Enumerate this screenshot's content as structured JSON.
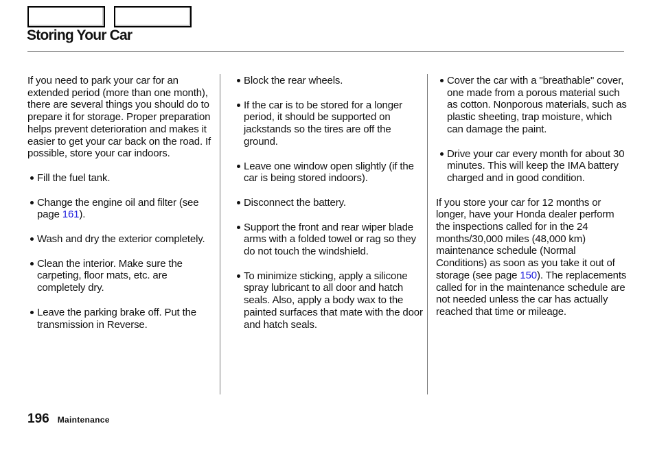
{
  "header": {
    "nav_buttons": [
      {
        "name": "nav-button-previous",
        "label": ""
      },
      {
        "name": "nav-button-next",
        "label": ""
      }
    ],
    "title": "Storing Your Car"
  },
  "columns": {
    "col1": {
      "intro": "If you need to park your car for an extended period (more than one month), there are several things you should do to prepare it for storage. Proper preparation helps prevent deterioration and makes it easier to get your car back on the road. If possible, store your car indoors.",
      "bullets": [
        {
          "text": "Fill the fuel tank."
        },
        {
          "text_before": "Change the engine oil and filter (see page ",
          "link": "161",
          "text_after": ")."
        },
        {
          "text": "Wash and dry the exterior completely."
        },
        {
          "text": "Clean the interior. Make sure the carpeting, floor mats, etc. are completely dry."
        },
        {
          "text": "Leave the parking brake off. Put the transmission in Reverse."
        }
      ]
    },
    "col2": {
      "bullets": [
        {
          "text": "Block the rear wheels."
        },
        {
          "text": "If the car is to be stored for a longer period, it should be supported on jackstands so the tires are off the ground."
        },
        {
          "text": "Leave one window open slightly (if the car is being stored indoors)."
        },
        {
          "text": "Disconnect the battery."
        },
        {
          "text": "Support the front and rear wiper blade arms with a folded towel or rag so they do not touch the windshield."
        },
        {
          "text": "To minimize sticking, apply a silicone spray lubricant to all door and hatch seals. Also, apply a body wax to the painted surfaces that mate with the door and hatch seals."
        }
      ]
    },
    "col3": {
      "bullets": [
        {
          "text": "Cover the car with a \"breathable\" cover, one made from a porous material such as cotton. Nonporous materials, such as plastic sheeting, trap moisture, which can damage the paint."
        },
        {
          "text": "Drive your car every month for about 30 minutes. This will keep the IMA battery charged and in good condition."
        }
      ],
      "closing": {
        "text_before": "If you store your car for 12 months or longer, have your Honda dealer perform the inspections called for in the 24 months/30,000 miles (48,000 km) maintenance schedule (Normal Conditions) as soon as you take it out of storage (see page ",
        "link": "150",
        "text_after": "). The replacements called for in the maintenance schedule are not needed unless the car has actually reached that time or mileage."
      }
    }
  },
  "footer": {
    "page_number": "196",
    "section": "Maintenance"
  },
  "colors": {
    "link": "#1a1adc",
    "text": "#111111",
    "rule": "#555555"
  }
}
